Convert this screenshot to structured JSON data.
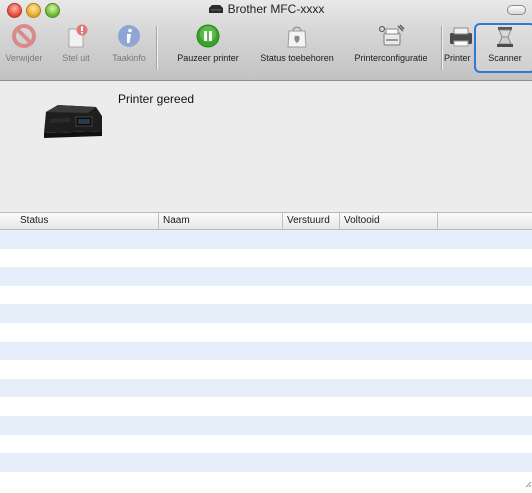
{
  "window": {
    "title": "Brother MFC-xxxx"
  },
  "toolbar": {
    "items": [
      {
        "label": "Verwijder",
        "icon": "delete-icon",
        "enabled": false
      },
      {
        "label": "Stel uit",
        "icon": "hold-icon",
        "enabled": false
      },
      {
        "label": "Taakinfo",
        "icon": "info-icon",
        "enabled": false
      },
      {
        "label": "Pauzeer printer",
        "icon": "pause-icon",
        "enabled": true
      },
      {
        "label": "Status toebehoren",
        "icon": "supply-status-icon",
        "enabled": true
      },
      {
        "label": "Printerconfiguratie",
        "icon": "printer-setup-icon",
        "enabled": true
      },
      {
        "label": "Printer",
        "icon": "printer-icon",
        "enabled": true
      },
      {
        "label": "Scanner",
        "icon": "scanner-icon",
        "enabled": true,
        "focused": true
      }
    ]
  },
  "status": {
    "text": "Printer gereed"
  },
  "table": {
    "columns": [
      "Status",
      "Naam",
      "Verstuurd",
      "Voltooid"
    ],
    "rows": []
  },
  "colors": {
    "focus_ring": "#2a7bd1",
    "row_stripe": "#e6eef9",
    "pause_green": "#3aa12a"
  }
}
